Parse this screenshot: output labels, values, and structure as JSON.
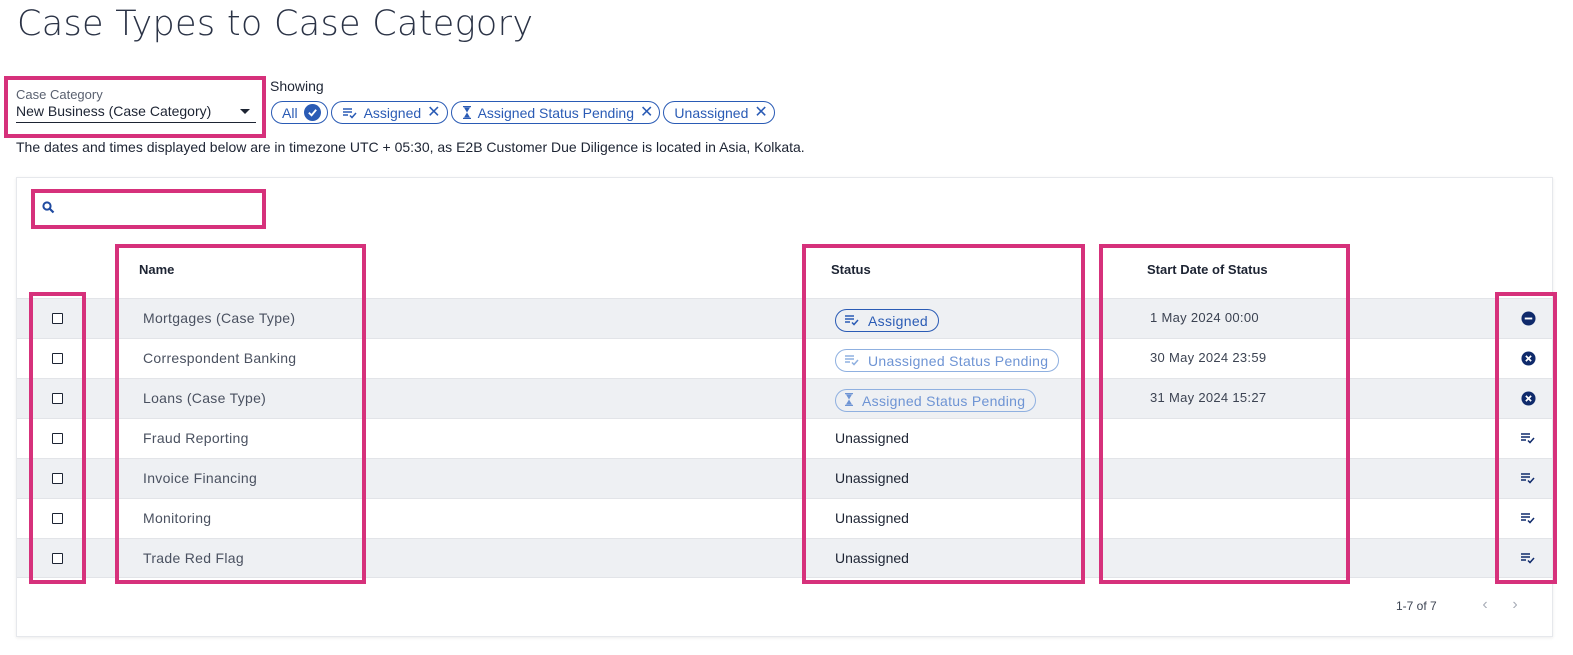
{
  "page": {
    "title": "Case Types to Case Category"
  },
  "case_category": {
    "label": "Case Category",
    "value": "New Business (Case Category)"
  },
  "filters": {
    "showing_label": "Showing",
    "chips": [
      {
        "label": "All",
        "icon": "check-circle-icon"
      },
      {
        "label": "Assigned",
        "icon": "assigned-list-icon"
      },
      {
        "label": "Assigned Status Pending",
        "icon": "hourglass-icon"
      },
      {
        "label": "Unassigned",
        "icon": ""
      }
    ]
  },
  "timezone_note": "The dates and times displayed below are in timezone UTC + 05:30, as E2B Customer Due Diligence is located in Asia, Kolkata.",
  "search": {
    "placeholder": "",
    "icon": "search-icon"
  },
  "table": {
    "columns": {
      "name": "Name",
      "status": "Status",
      "start_date": "Start Date of Status"
    },
    "rows": [
      {
        "name": "Mortgages (Case Type)",
        "status": "Assigned",
        "status_style": "pill-strong",
        "status_icon": "assigned-list-icon",
        "start_date": "1 May 2024 00:00",
        "action_icon": "remove-circle-icon"
      },
      {
        "name": "Correspondent Banking",
        "status": "Unassigned Status Pending",
        "status_style": "pill-faint",
        "status_icon": "assigned-list-icon",
        "start_date": "30 May 2024 23:59",
        "action_icon": "cancel-circle-icon"
      },
      {
        "name": "Loans (Case Type)",
        "status": "Assigned Status Pending",
        "status_style": "pill-faint",
        "status_icon": "hourglass-icon",
        "start_date": "31 May 2024 15:27",
        "action_icon": "cancel-circle-icon"
      },
      {
        "name": "Fraud Reporting",
        "status": "Unassigned",
        "status_style": "plain",
        "start_date": "",
        "action_icon": "assign-list-icon"
      },
      {
        "name": "Invoice Financing",
        "status": "Unassigned",
        "status_style": "plain",
        "start_date": "",
        "action_icon": "assign-list-icon"
      },
      {
        "name": "Monitoring",
        "status": "Unassigned",
        "status_style": "plain",
        "start_date": "",
        "action_icon": "assign-list-icon"
      },
      {
        "name": "Trade Red Flag",
        "status": "Unassigned",
        "status_style": "plain",
        "start_date": "",
        "action_icon": "assign-list-icon"
      }
    ]
  },
  "pagination": {
    "range": "1-7 of 7",
    "prev_icon": "chevron-left-icon",
    "next_icon": "chevron-right-icon"
  },
  "colors": {
    "accent": "#2a5bb5",
    "highlight": "#d6317b",
    "row_alt": "#eef0f3",
    "text": "#1d2433"
  }
}
